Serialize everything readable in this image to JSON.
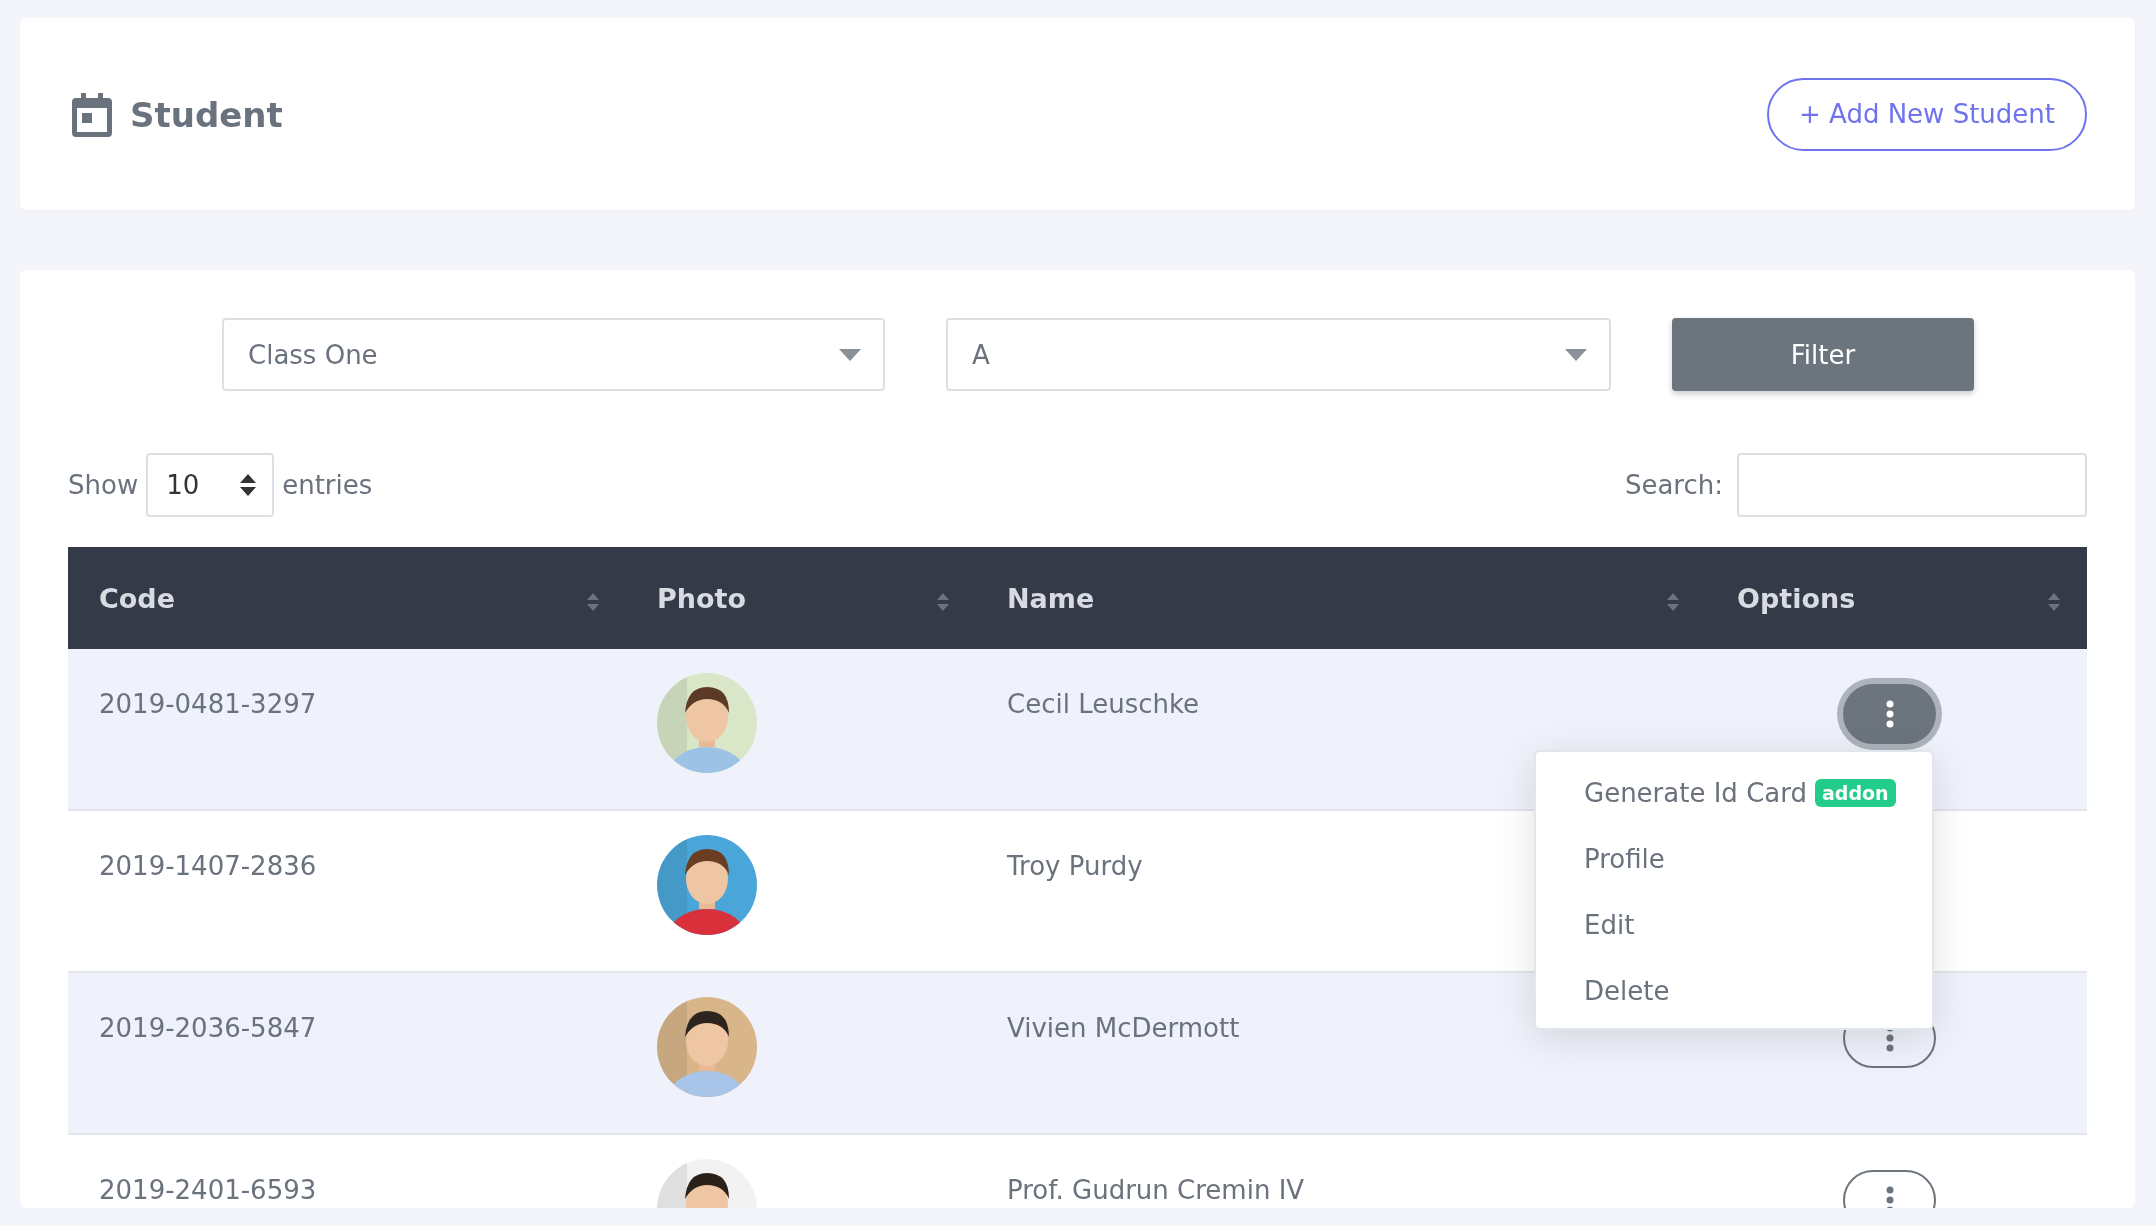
{
  "header": {
    "title": "Student",
    "add_button": "+ Add New Student"
  },
  "filters": {
    "class_select": "Class One",
    "section_select": "A",
    "filter_button": "Filter"
  },
  "length": {
    "show_label": "Show",
    "value": "10",
    "entries_label": "entries"
  },
  "search": {
    "label": "Search:"
  },
  "table": {
    "columns": [
      "Code",
      "Photo",
      "Name",
      "Options"
    ],
    "rows": [
      {
        "code": "2019-0481-3297",
        "name": "Cecil Leuschke",
        "menu_open": true
      },
      {
        "code": "2019-1407-2836",
        "name": "Troy Purdy",
        "menu_open": false
      },
      {
        "code": "2019-2036-5847",
        "name": "Vivien McDermott",
        "menu_open": false
      },
      {
        "code": "2019-2401-6593",
        "name": "Prof. Gudrun Cremin IV",
        "menu_open": false
      }
    ]
  },
  "options_menu": [
    {
      "label": "Generate Id Card",
      "badge": "addon"
    },
    {
      "label": "Profile"
    },
    {
      "label": "Edit"
    },
    {
      "label": "Delete"
    }
  ]
}
